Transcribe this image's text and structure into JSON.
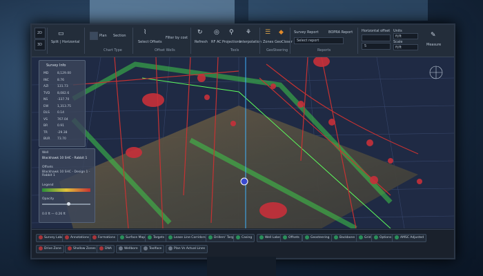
{
  "toolbar": {
    "split_label": "Split | Horizontal",
    "view_2d": "2D",
    "view_3d": "3D",
    "plan": "Plan",
    "section": "Section",
    "chart_type_group": "Chart Type",
    "select_offsets": "Select Offsets",
    "filter_by_cost": "Filter by cost",
    "offset_wells_group": "Offset Wells",
    "refresh": "Refresh",
    "rf_ac": "RF AC",
    "projections": "Projections",
    "interpolation": "Interpolation",
    "tools_group": "Tools",
    "zones": "Zones",
    "geocloser": "GeoCloser",
    "geosteering_group": "GeoSteering",
    "survey_report": "Survey Report",
    "bopra_report": "BOPRA Report",
    "select_report": "Select report",
    "reports_group": "Reports",
    "horizontal_offset": "Horizontal offset",
    "value_5": "5",
    "unit_label": "Units",
    "unit_value": "ft/ft",
    "unit_label_2": "Scale",
    "unit_value_2": "ft/ft",
    "measure": "Measure"
  },
  "survey_info": {
    "title": "Survey Info",
    "rows": [
      {
        "k": "MD",
        "v": "8,129.00"
      },
      {
        "k": "INC",
        "v": "8.76"
      },
      {
        "k": "AZI",
        "v": "131.73"
      },
      {
        "k": "TVD",
        "v": "8,082.6"
      },
      {
        "k": "NS",
        "v": "-337.70"
      },
      {
        "k": "EW",
        "v": "1,313.75"
      },
      {
        "k": "DLS",
        "v": "0.14"
      },
      {
        "k": "VS",
        "v": "767.04"
      },
      {
        "k": "BR",
        "v": "0.91"
      },
      {
        "k": "TR",
        "v": "-29.38"
      },
      {
        "k": "BUR",
        "v": "73.70"
      }
    ]
  },
  "well_panel": {
    "section_label": "Well",
    "well_name": "Blackhawk 10 SHC - Rabbit 1",
    "offsets_label": "Offsets",
    "offsets_value": "Blackhawk 10 SHC - Design 1 - Rabbit 1",
    "legend_label": "Legend",
    "opacity_label": "Opacity",
    "scale_text": "0.0 ft — 0.26 ft"
  },
  "bottom_row1": [
    {
      "label": "Survey Labels",
      "state": "red"
    },
    {
      "label": "Annotations",
      "state": "red"
    },
    {
      "label": "Formations",
      "state": "red"
    },
    {
      "label": "Surface Map",
      "state": "green"
    },
    {
      "label": "Targets",
      "state": "green"
    },
    {
      "label": "Lease Line Corridors",
      "state": "green"
    },
    {
      "label": "Drillers' Targets",
      "state": "green"
    },
    {
      "label": "Casing",
      "state": "green"
    },
    {
      "label": "Well Labels",
      "state": "green"
    },
    {
      "label": "Offsets",
      "state": "green"
    },
    {
      "label": "Geosteering",
      "state": "green"
    },
    {
      "label": "Backbone",
      "state": "green"
    },
    {
      "label": "Grid",
      "state": "green"
    },
    {
      "label": "Options",
      "state": "green"
    },
    {
      "label": "AMSC Adjusted",
      "state": "green"
    }
  ],
  "bottom_row2": [
    {
      "label": "Drive Zone",
      "state": "red"
    },
    {
      "label": "Shallow Zones",
      "state": "red"
    },
    {
      "label": "DNA",
      "state": "red"
    },
    {
      "label": "Wellbore",
      "state": "gray"
    },
    {
      "label": "Toolface",
      "state": "gray"
    },
    {
      "label": "Plan Vs Actual Lines",
      "state": "gray"
    }
  ]
}
